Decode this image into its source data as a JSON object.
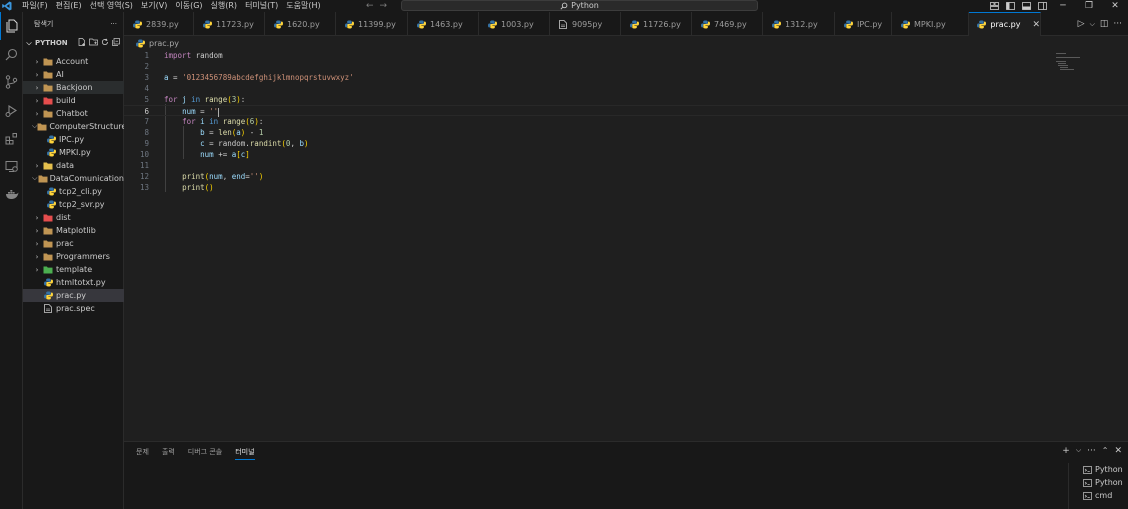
{
  "titlebar": {
    "menu": [
      "파일(F)",
      "편집(E)",
      "선택 영역(S)",
      "보기(V)",
      "이동(G)",
      "실행(R)",
      "터미널(T)",
      "도움말(H)"
    ],
    "search_text": "Python",
    "window_buttons": [
      "minimize",
      "restore",
      "close"
    ]
  },
  "activitybar": {
    "icons": [
      "files-icon",
      "search-icon",
      "source-control-icon",
      "run-debug-icon",
      "extensions-icon",
      "remote-explorer-icon",
      "docker-icon"
    ]
  },
  "sidebar": {
    "title": "탐색기",
    "more": "···",
    "workspace": "PYTHON",
    "items": [
      {
        "label": "Account",
        "type": "folder",
        "depth": 0,
        "expanded": false,
        "color": "#c09553"
      },
      {
        "label": "AI",
        "type": "folder",
        "depth": 0,
        "expanded": false,
        "color": "#c09553"
      },
      {
        "label": "Backjoon",
        "type": "folder",
        "depth": 0,
        "expanded": false,
        "color": "#c09553"
      },
      {
        "label": "build",
        "type": "folder",
        "depth": 0,
        "expanded": false,
        "color": "#e54d4d"
      },
      {
        "label": "Chatbot",
        "type": "folder",
        "depth": 0,
        "expanded": false,
        "color": "#c09553"
      },
      {
        "label": "ComputerStructure",
        "type": "folder",
        "depth": 0,
        "expanded": true,
        "color": "#c09553"
      },
      {
        "label": "IPC.py",
        "type": "python",
        "depth": 1
      },
      {
        "label": "MPKI.py",
        "type": "python",
        "depth": 1
      },
      {
        "label": "data",
        "type": "folder",
        "depth": 0,
        "expanded": false,
        "color": "#e5c04d"
      },
      {
        "label": "DataComunication",
        "type": "folder",
        "depth": 0,
        "expanded": true,
        "color": "#c09553"
      },
      {
        "label": "tcp2_cli.py",
        "type": "python",
        "depth": 1
      },
      {
        "label": "tcp2_svr.py",
        "type": "python",
        "depth": 1
      },
      {
        "label": "dist",
        "type": "folder",
        "depth": 0,
        "expanded": false,
        "color": "#e54d4d"
      },
      {
        "label": "Matplotlib",
        "type": "folder",
        "depth": 0,
        "expanded": false,
        "color": "#c09553"
      },
      {
        "label": "prac",
        "type": "folder",
        "depth": 0,
        "expanded": false,
        "color": "#c09553"
      },
      {
        "label": "Programmers",
        "type": "folder",
        "depth": 0,
        "expanded": false,
        "color": "#c09553"
      },
      {
        "label": "template",
        "type": "folder",
        "depth": 0,
        "expanded": false,
        "color": "#4caf50"
      },
      {
        "label": "htmltotxt.py",
        "type": "python",
        "depth": 0,
        "file": true
      },
      {
        "label": "prac.py",
        "type": "python",
        "depth": 0,
        "file": true,
        "selected": true
      },
      {
        "label": "prac.spec",
        "type": "doc",
        "depth": 0,
        "file": true
      }
    ]
  },
  "tabs": [
    {
      "label": "2839.py",
      "width": 70
    },
    {
      "label": "11723.py",
      "width": 71
    },
    {
      "label": "1620.py",
      "width": 71
    },
    {
      "label": "11399.py",
      "width": 72
    },
    {
      "label": "1463.py",
      "width": 71
    },
    {
      "label": "1003.py",
      "width": 71
    },
    {
      "label": "9095py",
      "width": 71,
      "doc": true
    },
    {
      "label": "11726.py",
      "width": 71
    },
    {
      "label": "7469.py",
      "width": 71
    },
    {
      "label": "1312.py",
      "width": 72
    },
    {
      "label": "IPC.py",
      "width": 57
    },
    {
      "label": "MPKI.py",
      "width": 77
    },
    {
      "label": "prac.py",
      "width": 72,
      "active": true
    }
  ],
  "breadcrumb": "prac.py",
  "editor": {
    "active_line": 6,
    "line_numbers": [
      "1",
      "2",
      "3",
      "4",
      "5",
      "6",
      "7",
      "8",
      "9",
      "10",
      "11",
      "12",
      "13"
    ]
  },
  "panel": {
    "tabs": [
      "문제",
      "출력",
      "디버그 콘솔",
      "터미널"
    ],
    "active_tab": "터미널",
    "terminals": [
      "Python",
      "Python",
      "cmd"
    ]
  },
  "colors": {
    "accent": "#0078d4",
    "python_blue": "#3572a5",
    "python_yellow": "#ffd43b"
  }
}
